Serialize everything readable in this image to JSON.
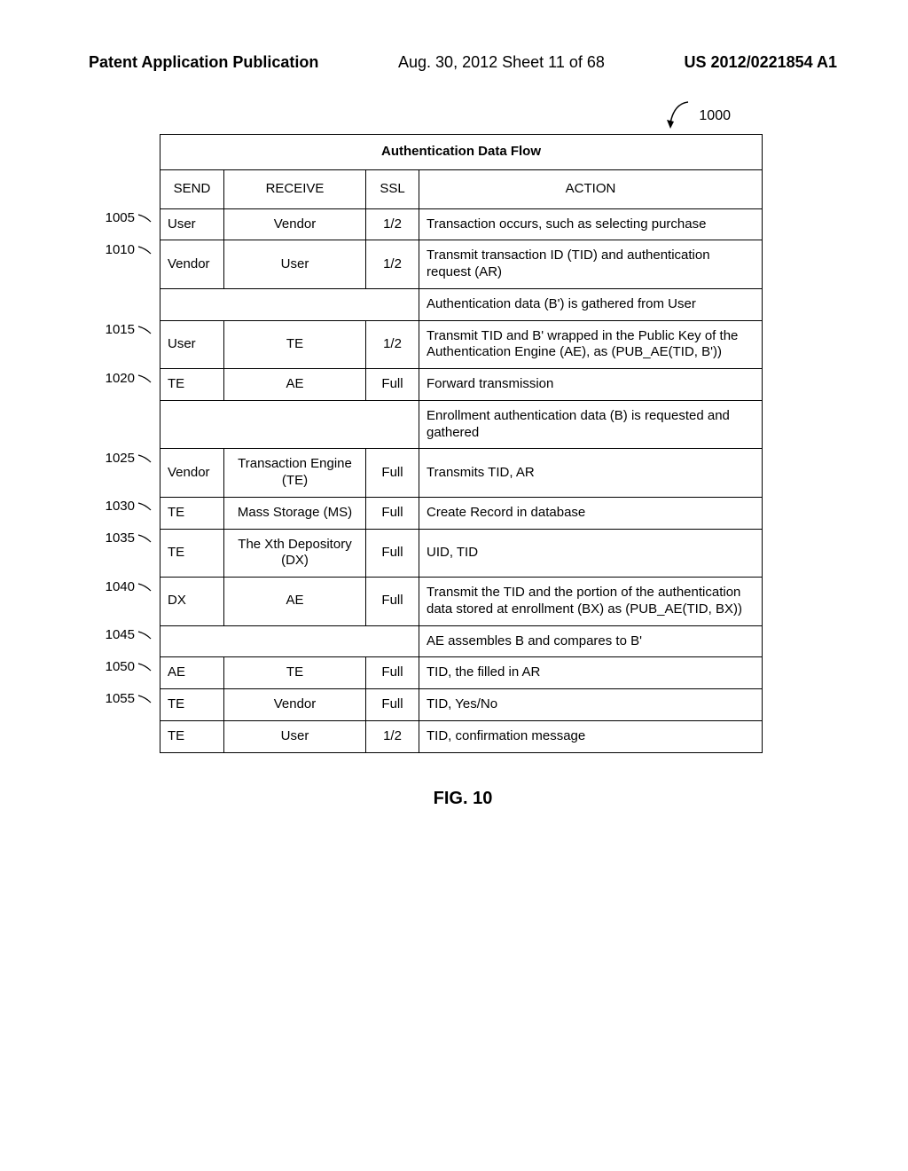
{
  "header": {
    "left": "Patent Application Publication",
    "center": "Aug. 30, 2012  Sheet 11 of 68",
    "right": "US 2012/0221854 A1"
  },
  "figure": {
    "ref_num": "1000",
    "caption": "FIG. 10",
    "table_title": "Authentication Data Flow",
    "columns": {
      "send": "SEND",
      "receive": "RECEIVE",
      "ssl": "SSL",
      "action": "ACTION"
    },
    "row_labels": [
      "1005",
      "1010",
      "1015",
      "1020",
      "1025",
      "1030",
      "1035",
      "1040",
      "1045",
      "1050",
      "1055"
    ],
    "rows": [
      {
        "label": "1005",
        "send": "User",
        "receive": "Vendor",
        "ssl": "1/2",
        "action": "Transaction occurs, such as selecting purchase"
      },
      {
        "label": "1010",
        "send": "Vendor",
        "receive": "User",
        "ssl": "1/2",
        "action": "Transmit transaction ID (TID) and authentication request (AR)"
      },
      {
        "label": "",
        "send": "",
        "receive": "",
        "ssl": "",
        "action": "Authentication data (B') is gathered from User"
      },
      {
        "label": "1015",
        "send": "User",
        "receive": "TE",
        "ssl": "1/2",
        "action": "Transmit TID and B' wrapped in the Public Key of the Authentication Engine (AE), as (PUB_AE(TID, B'))"
      },
      {
        "label": "1020",
        "send": "TE",
        "receive": "AE",
        "ssl": "Full",
        "action": "Forward transmission"
      },
      {
        "label": "",
        "send": "",
        "receive": "",
        "ssl": "",
        "action": "Enrollment authentication data (B) is requested and gathered"
      },
      {
        "label": "1025",
        "send": "Vendor",
        "receive": "Transaction Engine (TE)",
        "ssl": "Full",
        "action": "Transmits TID, AR"
      },
      {
        "label": "1030",
        "send": "TE",
        "receive": "Mass Storage (MS)",
        "ssl": "Full",
        "action": "Create Record in database"
      },
      {
        "label": "1035",
        "send": "TE",
        "receive": "The Xth Depository (DX)",
        "ssl": "Full",
        "action": "UID, TID"
      },
      {
        "label": "1040",
        "send": "DX",
        "receive": "AE",
        "ssl": "Full",
        "action": "Transmit the TID and the portion of the authentication data stored at enrollment (BX) as (PUB_AE(TID, BX))"
      },
      {
        "label": "1045",
        "send": "",
        "receive": "",
        "ssl": "",
        "action": "AE assembles B and compares to B'"
      },
      {
        "label": "1050",
        "send": "AE",
        "receive": "TE",
        "ssl": "Full",
        "action": "TID, the filled in AR"
      },
      {
        "label": "1055",
        "send": "TE",
        "receive": "Vendor",
        "ssl": "Full",
        "action": "TID, Yes/No"
      },
      {
        "label": "",
        "send": "TE",
        "receive": "User",
        "ssl": "1/2",
        "action": "TID, confirmation message"
      }
    ]
  }
}
